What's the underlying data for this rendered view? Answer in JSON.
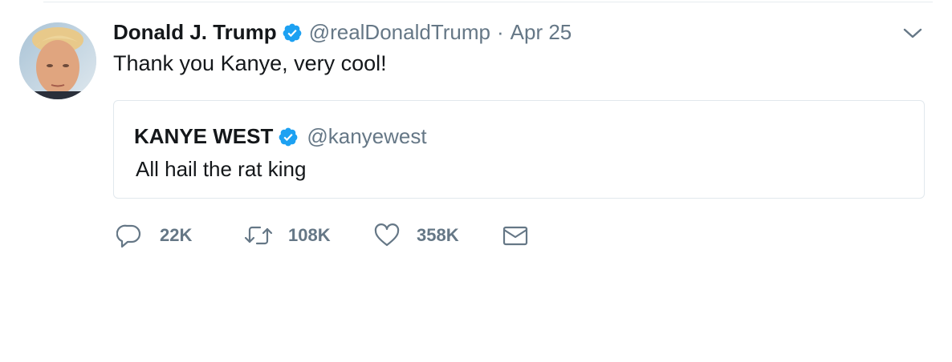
{
  "tweet": {
    "display_name": "Donald J. Trump",
    "handle": "@realDonaldTrump",
    "separator": "·",
    "time": "Apr 25",
    "text": "Thank you Kanye, very cool!",
    "verified": true,
    "avatar_icon": "user-avatar-photo",
    "menu_icon": "chevron-down-icon"
  },
  "quoted_tweet": {
    "display_name": "KANYE WEST",
    "handle": "@kanyewest",
    "text": "All hail the rat king",
    "verified": true
  },
  "actions": {
    "reply_count": "22K",
    "retweet_count": "108K",
    "like_count": "358K",
    "reply_icon": "reply-icon",
    "retweet_icon": "retweet-icon",
    "like_icon": "heart-icon",
    "dm_icon": "envelope-icon"
  },
  "colors": {
    "text_primary": "#14171a",
    "text_secondary": "#657786",
    "verified_badge": "#1da1f2",
    "border": "#e1e8ed"
  }
}
